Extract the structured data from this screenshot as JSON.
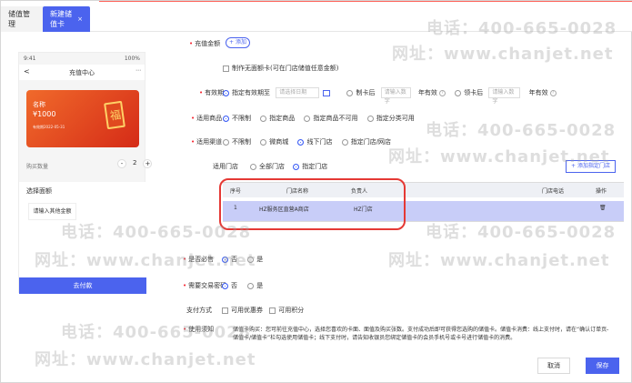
{
  "tabs": {
    "inactive": "储值管理",
    "active": "新建储值卡",
    "close": "×"
  },
  "phone": {
    "status_left": "9:41",
    "status_right": "100%",
    "back": "<",
    "title": "充值中心",
    "menu": "⋯",
    "card_name": "名称",
    "card_price": "¥1000",
    "card_date": "有效期2022-05-31",
    "buy_count_label": "购买数量",
    "minus": "-",
    "count": "2",
    "plus": "+",
    "choose_amount": "选择面额",
    "custom_amount": "请输入其他金额",
    "pay": "去付款"
  },
  "form": {
    "amount_label": "充值金额",
    "add": "+ 添加",
    "noface_check": "制作无面额卡(可在门店储值任意金额)",
    "valid_label": "有效期",
    "valid_fixed": "指定有效期至",
    "date_placeholder": "请选择日期",
    "card_after": "制卡后",
    "num_ph1": "请输入数字",
    "year_valid": "年有效",
    "active_after": "领卡后",
    "num_ph2": "请输入数字",
    "year_valid2": "年有效",
    "goods_label": "适用商品",
    "goods_unlimited": "不限制",
    "goods_specified": "指定商品",
    "goods_not": "指定商品不可用",
    "goods_cat": "指定分类可用",
    "channel_label": "适用渠道",
    "channel_unlimited": "不限制",
    "channel_wechat": "微商城",
    "channel_offline": "线下门店",
    "channel_store": "指定门店/网店",
    "store_label": "适用门店",
    "store_all": "全部门店",
    "store_specified": "指定门店",
    "add_store": "+ 添加指定门店",
    "table": {
      "headers": [
        "序号",
        "门店名称",
        "负责人",
        "门店电话",
        "操作"
      ],
      "rows": [
        {
          "no": "1",
          "name": "HZ服务区直营A商店",
          "manager": "HZ门店",
          "phone": "",
          "action": "🗑"
        }
      ]
    },
    "coupon_label": "是否必售",
    "coupon_no": "否",
    "coupon_yes": "是",
    "password_label": "需要交易密码",
    "password_no": "否",
    "password_yes": "是",
    "pay_label": "支付方式",
    "pay_coupon": "可用优惠券",
    "pay_points": "可用积分",
    "notice_label": "使用须知",
    "notice_text": "储值卡购买：您可前往充值中心，选择您喜欢的卡面、面值及购买张数。支付成功后即可获得您选购的储值卡。储值卡消费：线上支付时，请在“确认订单页-储值卡/储值卡”栏勾选使用储值卡；线下支付时，请告知收银员您绑定储值卡的会员手机号或卡号进行储值卡的消费。",
    "cancel": "取消",
    "save": "保存"
  },
  "watermarks": [
    "电话：400-665-0028",
    "网址：www.chanjet.net"
  ]
}
